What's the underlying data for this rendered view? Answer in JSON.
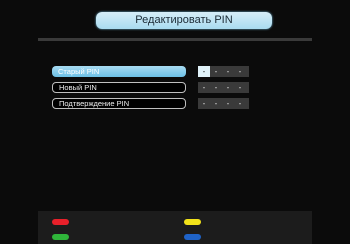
{
  "window": {
    "title": "Редактировать PIN"
  },
  "pin_rows": [
    {
      "label": "Старый PIN",
      "selected": true,
      "digits": [
        "-",
        "-",
        "-",
        "-"
      ]
    },
    {
      "label": "Новый PIN",
      "selected": false,
      "digits": [
        "-",
        "-",
        "-",
        "-"
      ]
    },
    {
      "label": "Подтверждение PIN",
      "selected": false,
      "digits": [
        "-",
        "-",
        "-",
        "-"
      ]
    }
  ],
  "color_keys": {
    "red": "#e8202a",
    "yellow": "#f2e21a",
    "green": "#2fb53a",
    "blue": "#1f63c8"
  }
}
